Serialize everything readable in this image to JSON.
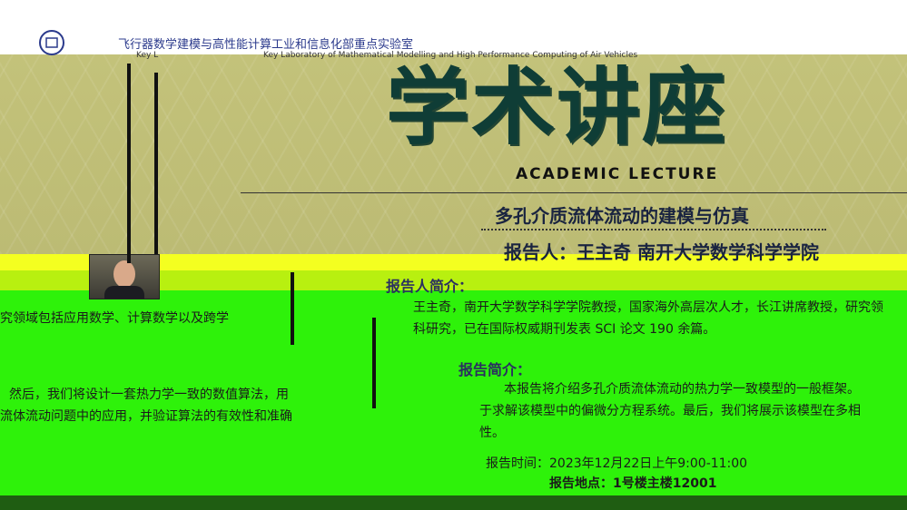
{
  "header": {
    "lab_name_cn": "飞行器数学建模与高性能计算工业和信息化部重点实验室",
    "lab_name_en": "Key Laboratory of Mathematical Modelling and High Performance Computing of Air Vehicles",
    "lab_name_en_left": "Key L"
  },
  "poster": {
    "title_cn": "学术讲座",
    "title_en": "ACADEMIC LECTURE",
    "lecture_title": "多孔介质流体流动的建模与仿真",
    "speaker_line": "报告人：王主奇 南开大学数学科学学院"
  },
  "sections": {
    "speaker_intro_head": "报告人简介：",
    "speaker_intro_line1": "王主奇，南开大学数学科学学院教授，国家海外高层次人才，长江讲席教授，研究领",
    "speaker_intro_line2": "科研究，已在国际权威期刊发表 SCI 论文 190 余篇。",
    "speaker_intro_left": "究领域包括应用数学、计算数学以及跨学",
    "abstract_head": "报告简介：",
    "abstract_line1": "本报告将介绍多孔介质流体流动的热力学一致模型的一般框架。",
    "abstract_line2": "于求解该模型中的偏微分方程系统。最后，我们将展示该模型在多相",
    "abstract_line3": "性。",
    "abstract_left1": "然后，我们将设计一套热力学一致的数值算法，用",
    "abstract_left2": "流体流动问题中的应用，并验证算法的有效性和准确",
    "time": "报告时间：2023年12月22日上午9:00-11:00",
    "place": "报告地点：1号楼主楼12001"
  }
}
